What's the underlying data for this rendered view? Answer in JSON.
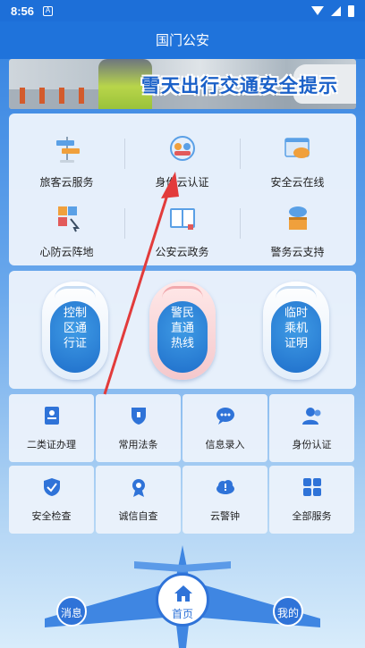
{
  "status_bar": {
    "time": "8:56",
    "notification_icon": "A"
  },
  "header": {
    "title": "国门公安"
  },
  "banner": {
    "title": "雪天出行交通安全提示"
  },
  "services": [
    {
      "label": "旅客云服务",
      "icon": "signpost-icon"
    },
    {
      "label": "身份云认证",
      "icon": "identity-badge-icon"
    },
    {
      "label": "安全云在线",
      "icon": "cloud-browser-icon"
    },
    {
      "label": "心防云阵地",
      "icon": "cubes-icon"
    },
    {
      "label": "公安云政务",
      "icon": "book-icon"
    },
    {
      "label": "警务云支持",
      "icon": "cloud-box-icon"
    }
  ],
  "hotlines": [
    {
      "lines": [
        "控制",
        "区通",
        "行证"
      ],
      "color": "#1f6fcb"
    },
    {
      "lines": [
        "警民",
        "直通",
        "热线"
      ],
      "color": "#1f6fcb"
    },
    {
      "lines": [
        "临时",
        "乘机",
        "证明"
      ],
      "color": "#1f6fcb"
    }
  ],
  "grid": [
    {
      "label": "二类证办理",
      "icon": "id-card-icon"
    },
    {
      "label": "常用法条",
      "icon": "law-shield-icon"
    },
    {
      "label": "信息录入",
      "icon": "chat-bubble-icon"
    },
    {
      "label": "身份认证",
      "icon": "users-icon"
    },
    {
      "label": "安全检查",
      "icon": "check-shield-icon"
    },
    {
      "label": "诚信自查",
      "icon": "medal-icon"
    },
    {
      "label": "云警钟",
      "icon": "cloud-alert-icon"
    },
    {
      "label": "全部服务",
      "icon": "grid-icon"
    }
  ],
  "nav": {
    "messages": "消息",
    "home": "首页",
    "mine": "我的"
  },
  "colors": {
    "primary": "#1f73db",
    "accent_red": "#e23b3b"
  }
}
